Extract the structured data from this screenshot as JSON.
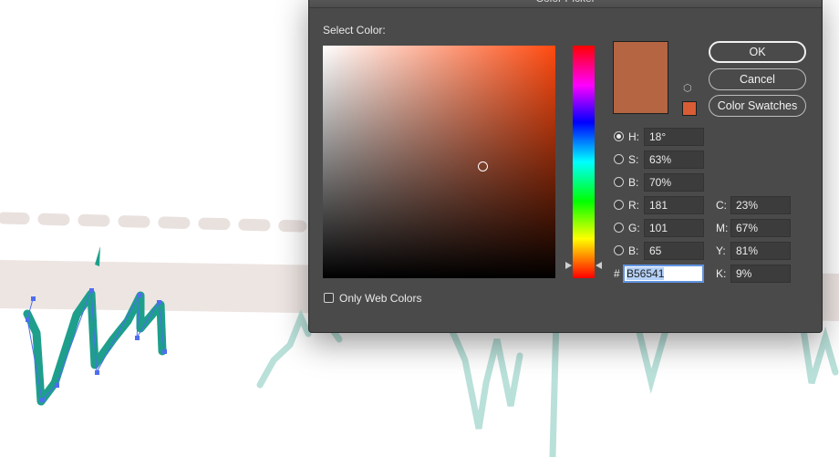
{
  "dialog": {
    "title": "Color Picker",
    "select_label": "Select Color:",
    "buttons": {
      "ok": "OK",
      "cancel": "Cancel",
      "swatches": "Color Swatches"
    },
    "hsb": [
      {
        "label": "H:",
        "value": "18°",
        "selected": true
      },
      {
        "label": "S:",
        "value": "63%",
        "selected": false
      },
      {
        "label": "B:",
        "value": "70%",
        "selected": false
      }
    ],
    "rgb": [
      {
        "label": "R:",
        "value": "181"
      },
      {
        "label": "G:",
        "value": "101"
      },
      {
        "label": "B:",
        "value": "65"
      }
    ],
    "cmyk": [
      {
        "label": "C:",
        "value": "23%"
      },
      {
        "label": "M:",
        "value": "67%"
      },
      {
        "label": "Y:",
        "value": "81%"
      },
      {
        "label": "K:",
        "value": "9%"
      }
    ],
    "hex_label": "#",
    "hex_value": "B56541",
    "web_colors_label": "Only Web Colors",
    "colors": {
      "current": "#b56541",
      "new_swatch": "#d85d35",
      "hue": "#ff4a10"
    }
  },
  "canvas": {
    "colors": {
      "dash": "#e9e1de",
      "band": "#ede5e2",
      "stroke": "#1e9f8c",
      "faint_stroke": "#b9e0d9",
      "anchor": "#4f6df0"
    }
  }
}
